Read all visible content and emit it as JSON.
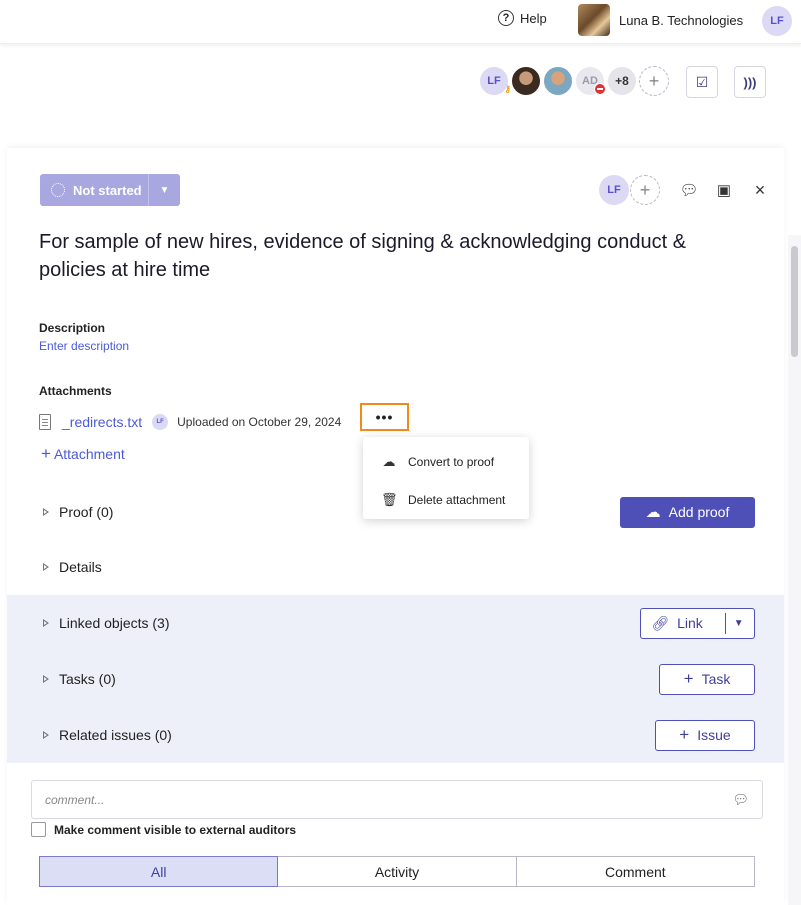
{
  "topbar": {
    "help_icon": "help-circle-icon",
    "help_label": "Help",
    "org_name": "Luna B. Technologies",
    "user_initials": "LF"
  },
  "members": {
    "initials_lf": "LF",
    "initials_ad": "AD",
    "more_count": "+8"
  },
  "panel": {
    "status_label": "Not started",
    "assignee_initials": "LF",
    "title": "For sample of new hires, evidence of signing & acknowledging conduct & policies at hire time",
    "description_label": "Description",
    "description_placeholder": "Enter description",
    "attachments_label": "Attachments",
    "attachment": {
      "file_name": "_redirects.txt",
      "uploader_initials": "LF",
      "uploaded_text": "Uploaded on October 29, 2024",
      "more_label": "•••"
    },
    "add_attachment_label": "Attachment"
  },
  "context_menu": {
    "items": [
      {
        "label": "Convert to proof",
        "icon": "cloud-upload-icon"
      },
      {
        "label": "Delete attachment",
        "icon": "trash-icon"
      }
    ]
  },
  "sections": {
    "proof": "Proof (0)",
    "add_proof": "Add proof",
    "details": "Details",
    "linked": "Linked objects (3)",
    "link_btn": "Link",
    "tasks": "Tasks (0)",
    "task_btn": "Task",
    "issues": "Related issues (0)",
    "issue_btn": "Issue"
  },
  "comment": {
    "placeholder": "comment...",
    "visibility_label": "Make comment visible to external auditors"
  },
  "tabs": [
    "All",
    "Activity",
    "Comment"
  ]
}
